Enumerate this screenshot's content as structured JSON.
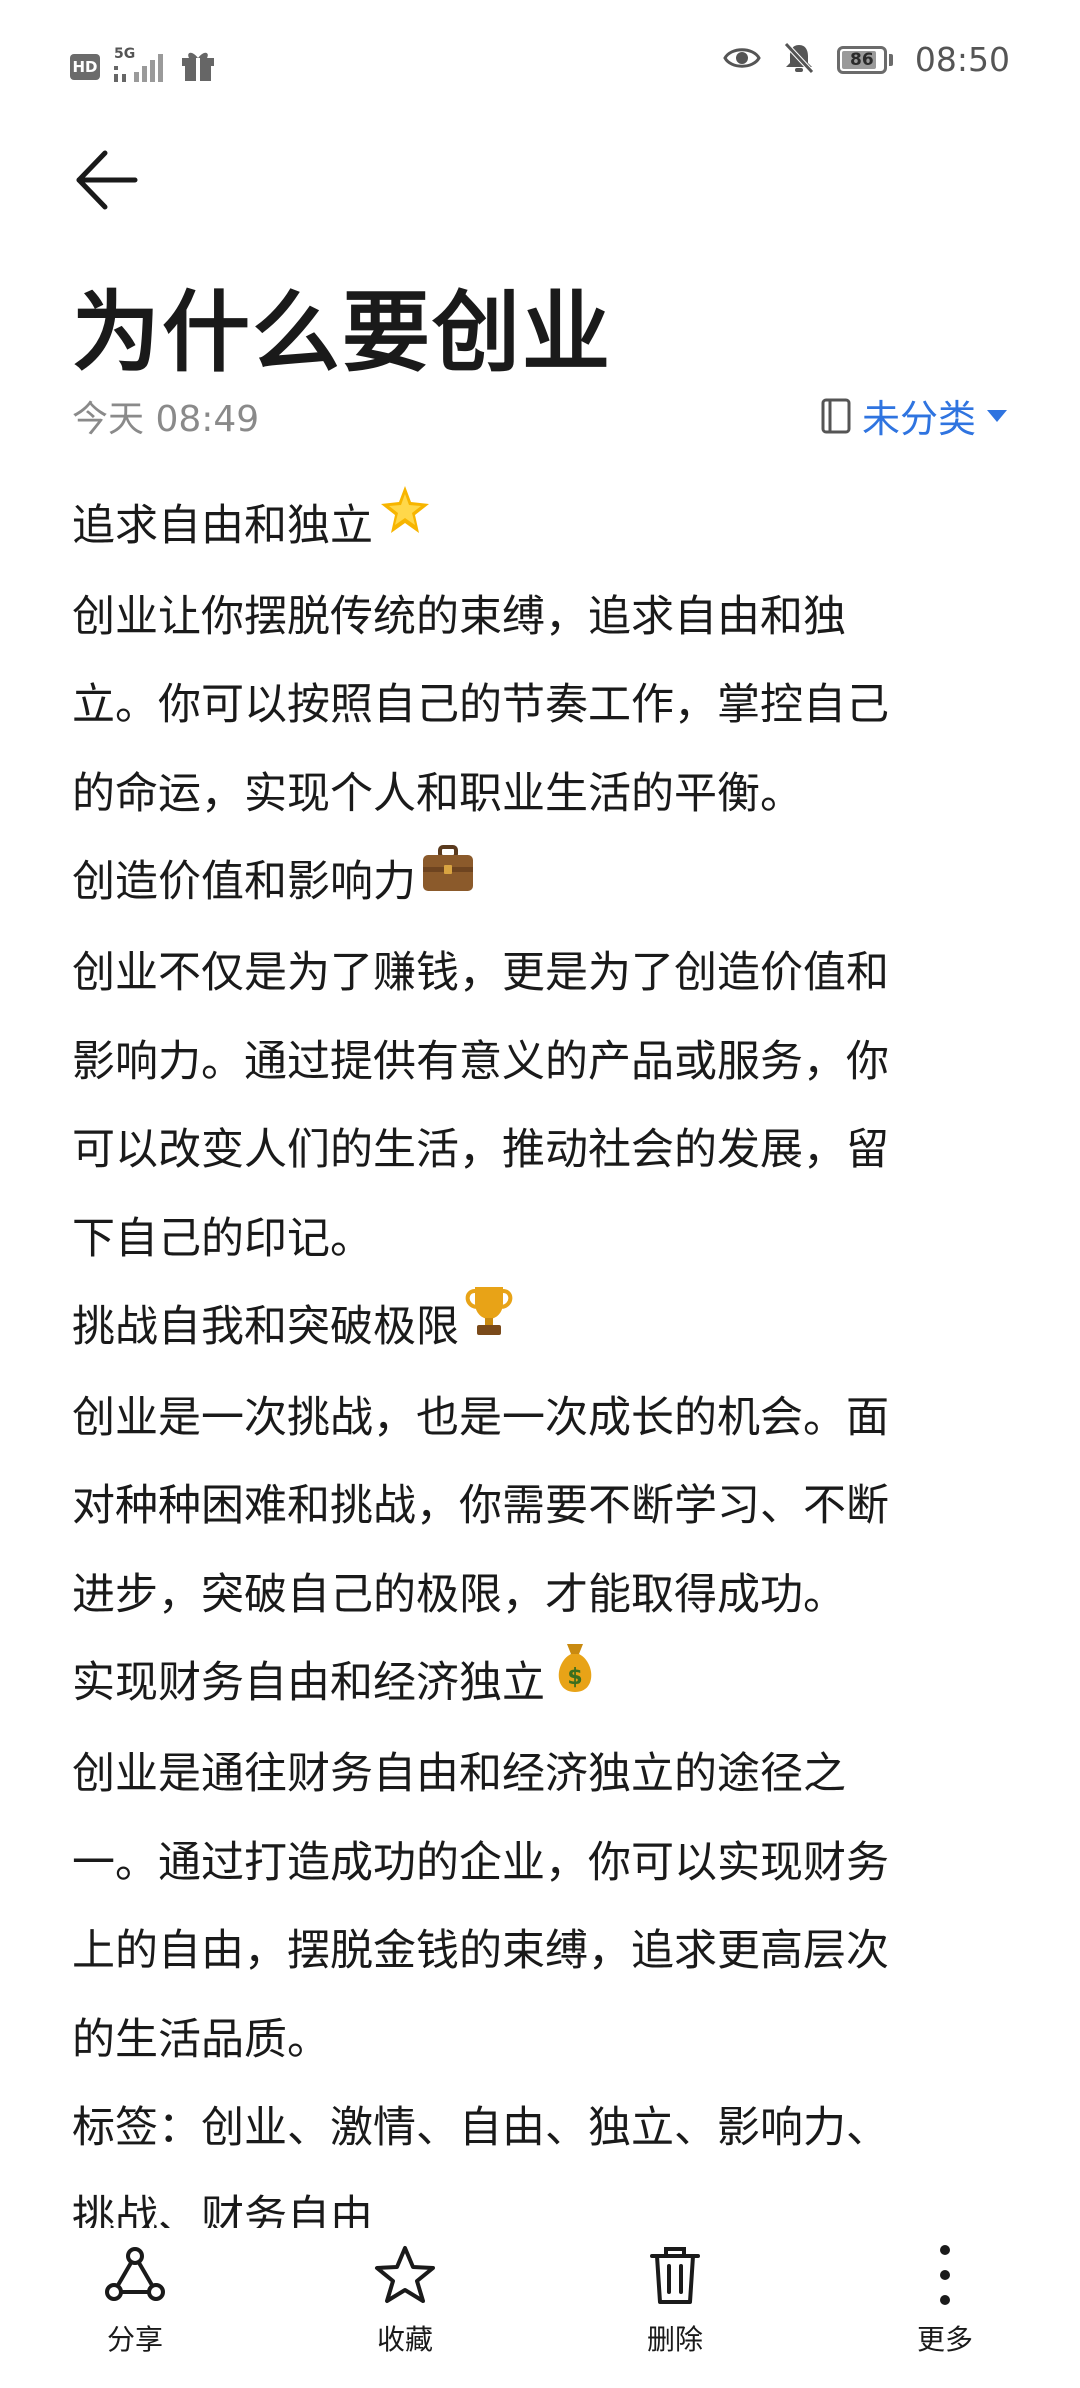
{
  "status_bar": {
    "hd": "HD",
    "signal": "5G",
    "battery_level": "86",
    "battery_fraction": 0.86,
    "time": "08:50"
  },
  "note": {
    "title": "为什么要创业",
    "date": "今天 08:49",
    "category": "未分类",
    "lines": [
      "追求自由和独立",
      "创业让你摆脱传统的束缚，追求自由和独",
      "立。你可以按照自己的节奏工作，掌控自己",
      "的命运，实现个人和职业生活的平衡。",
      "创造价值和影响力",
      "创业不仅是为了赚钱，更是为了创造价值和",
      "影响力。通过提供有意义的产品或服务，你",
      "可以改变人们的生活，推动社会的发展，留",
      "下自己的印记。",
      "挑战自我和突破极限",
      "创业是一次挑战，也是一次成长的机会。面",
      "对种种困难和挑战，你需要不断学习、不断",
      "进步，突破自己的极限，才能取得成功。",
      "实现财务自由和经济独立",
      "创业是通往财务自由和经济独立的途径之",
      "一。通过打造成功的企业，你可以实现财务",
      "上的自由，摆脱金钱的束缚，追求更高层次",
      "的生活品质。",
      "标签：创业、激情、自由、独立、影响力、",
      "挑战、财务自由"
    ],
    "emojis": {
      "star": "glowing-star-icon",
      "briefcase": "briefcase-icon",
      "trophy": "trophy-icon",
      "money_bag": "money-bag-icon"
    }
  },
  "toolbar": {
    "share": "分享",
    "favorite": "收藏",
    "delete": "删除",
    "more": "更多"
  },
  "colors": {
    "accent": "#2f74e0",
    "text": "#1a1a1a",
    "muted": "#8a8a8a"
  }
}
